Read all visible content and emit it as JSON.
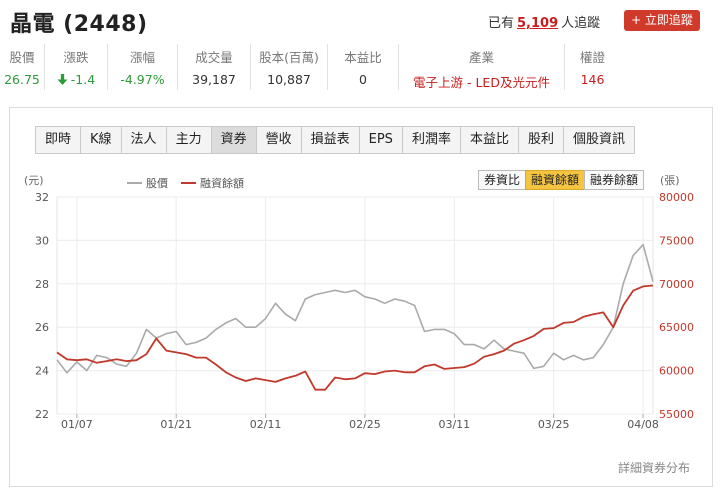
{
  "header": {
    "title": "晶電 (2448)",
    "followers_prefix": "已有",
    "followers_count": "5,109",
    "followers_suffix": "人追蹤",
    "follow_button": "+ 立即追蹤"
  },
  "stats": [
    {
      "label": "股價",
      "value": "26.75",
      "color": "#2e9b3a"
    },
    {
      "label": "漲跌",
      "value": "-1.4",
      "color": "#2e9b3a",
      "icon": "arrow-down-icon"
    },
    {
      "label": "漲幅",
      "value": "-4.97%",
      "color": "#2e9b3a"
    },
    {
      "label": "成交量",
      "value": "39,187"
    },
    {
      "label": "股本(百萬)",
      "value": "10,887"
    },
    {
      "label": "本益比",
      "value": "0"
    },
    {
      "label": "產業",
      "value": "電子上游 - LED及光元件",
      "color": "#c81e1e"
    },
    {
      "label": "權證",
      "value": "146",
      "color": "#c81e1e"
    }
  ],
  "tabs": [
    "即時",
    "K線",
    "法人",
    "主力",
    "資券",
    "營收",
    "損益表",
    "EPS",
    "利潤率",
    "本益比",
    "股利",
    "個股資訊"
  ],
  "active_tab": "資券",
  "sub_tabs": [
    "券資比",
    "融資餘額",
    "融券餘額"
  ],
  "active_sub_tab": "融資餘額",
  "footer_link": "詳細資券分布",
  "chart_data": {
    "type": "line",
    "left_axis_label": "(元)",
    "right_axis_label": "(張)",
    "left_ylim": [
      22,
      32
    ],
    "right_ylim": [
      55000,
      80000
    ],
    "left_ticks": [
      "32",
      "30",
      "28",
      "26",
      "24",
      "22"
    ],
    "right_ticks": [
      "80000",
      "75000",
      "70000",
      "65000",
      "60000",
      "55000"
    ],
    "x_tick_labels": [
      "01/07",
      "01/21",
      "02/11",
      "02/25",
      "03/11",
      "03/25",
      "04/08"
    ],
    "x_tick_index": [
      2,
      12,
      21,
      31,
      40,
      50,
      59
    ],
    "grid": true,
    "legend_position": "top-center",
    "colors": {
      "price": "#aaaaaa",
      "margin": "#c0392b"
    },
    "series": [
      {
        "name": "股價",
        "axis": "left",
        "values": [
          24.5,
          23.9,
          24.4,
          24.0,
          24.7,
          24.6,
          24.3,
          24.2,
          24.8,
          25.9,
          25.5,
          25.7,
          25.8,
          25.2,
          25.3,
          25.5,
          25.9,
          26.2,
          26.4,
          26.0,
          26.0,
          26.4,
          27.1,
          26.6,
          26.3,
          27.3,
          27.5,
          27.6,
          27.7,
          27.6,
          27.7,
          27.4,
          27.3,
          27.1,
          27.3,
          27.2,
          27.0,
          25.8,
          25.9,
          25.9,
          25.7,
          25.2,
          25.2,
          25.0,
          25.4,
          25.0,
          24.9,
          24.8,
          24.1,
          24.2,
          24.8,
          24.5,
          24.7,
          24.5,
          24.6,
          25.2,
          26.0,
          28.0,
          29.3,
          29.8,
          28.1
        ]
      },
      {
        "name": "融資餘額",
        "axis": "right",
        "values": [
          62100,
          61300,
          61200,
          61300,
          60900,
          61100,
          61300,
          61100,
          61200,
          61900,
          63700,
          62300,
          62100,
          61900,
          61500,
          61500,
          60700,
          59800,
          59200,
          58800,
          59100,
          58900,
          58700,
          59100,
          59400,
          59900,
          57800,
          57800,
          59200,
          59000,
          59100,
          59700,
          59600,
          59900,
          60000,
          59800,
          59800,
          60500,
          60700,
          60200,
          60300,
          60400,
          60800,
          61600,
          61900,
          62300,
          63100,
          63500,
          64000,
          64800,
          64900,
          65500,
          65600,
          66200,
          66500,
          66700,
          65000,
          67500,
          69200,
          69700,
          69800
        ]
      }
    ]
  }
}
